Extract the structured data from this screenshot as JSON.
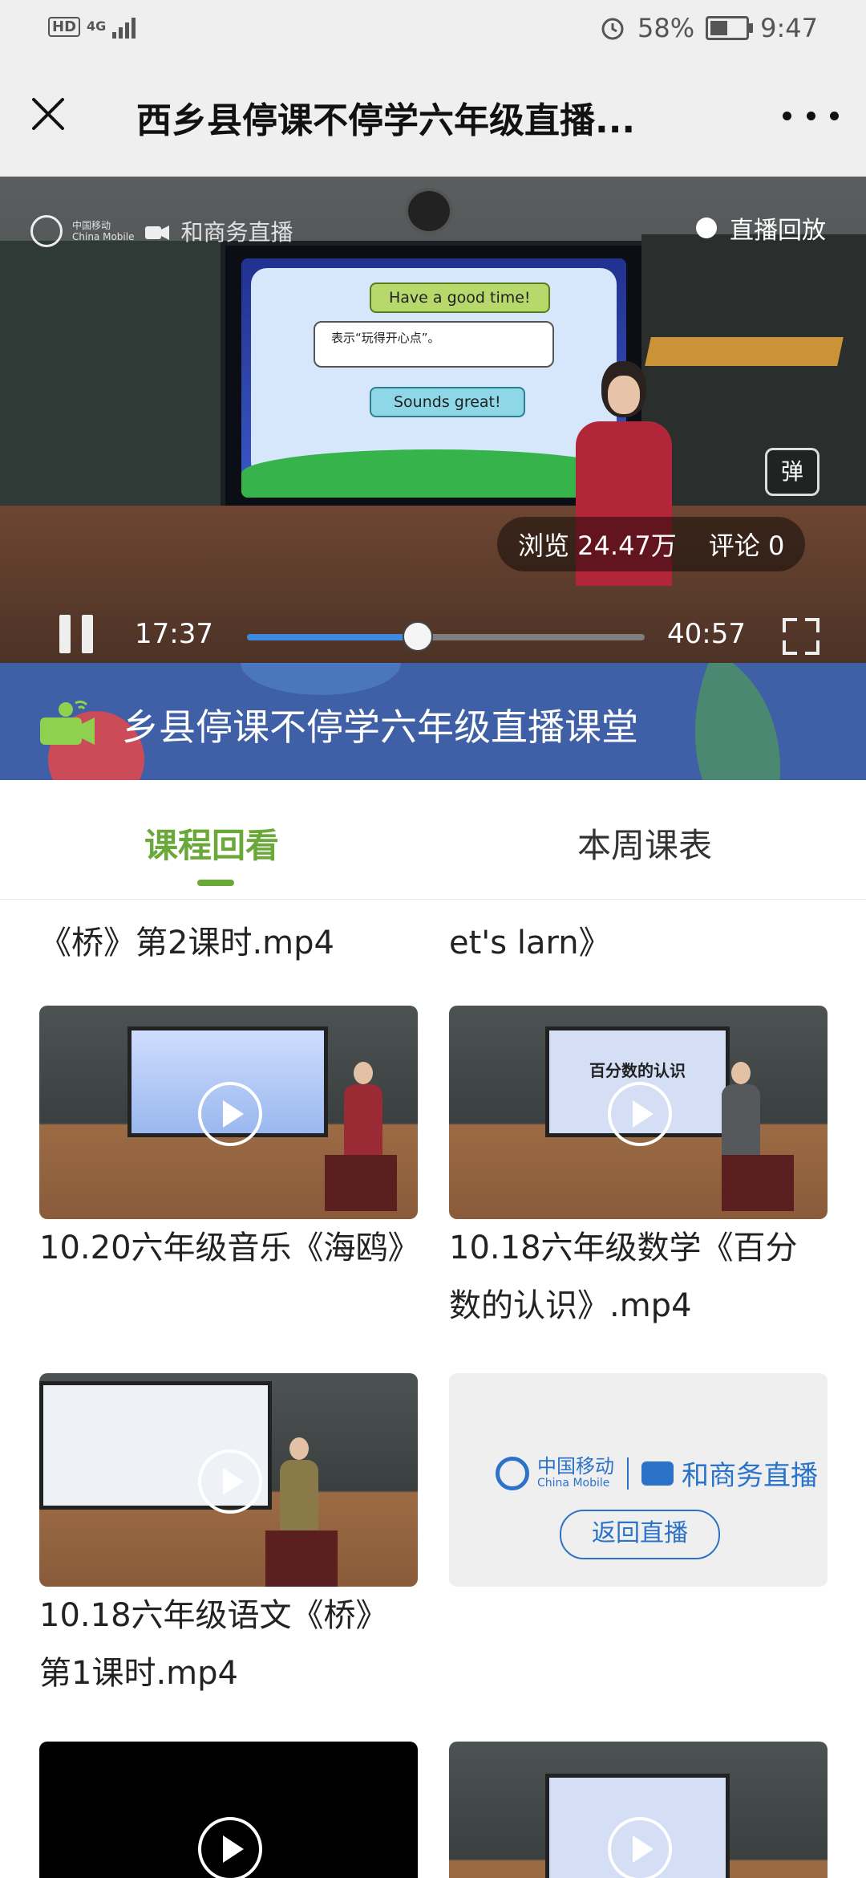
{
  "status_bar": {
    "hd": "HD",
    "network": "4G",
    "battery_percent": "58%",
    "time": "9:47",
    "battery_level": 0.58
  },
  "header": {
    "title": "西乡县停课不停学六年级直播..."
  },
  "player": {
    "brand_text": "和商务直播",
    "brand_cm_cn": "中国移动",
    "brand_cm_en": "China Mobile",
    "replay_label": "直播回放",
    "danmu_label": "弹",
    "views": "浏览 24.47万",
    "comments": "评论 0",
    "current_time": "17:37",
    "total_time": "40:57",
    "progress_fraction": 0.43,
    "slide": {
      "line1": "Have a good time!",
      "line2": "表示“玩得开心点”。",
      "line3": "Sounds great!"
    }
  },
  "banner": {
    "title": "乡县停课不停学六年级直播课堂"
  },
  "tabs": [
    {
      "label": "课程回看",
      "active": true
    },
    {
      "label": "本周课表",
      "active": false
    }
  ],
  "videos": {
    "partial_left": {
      "title_line1": "《桥》第2课时.mp4"
    },
    "partial_right": {
      "title_line1": "et's larn》"
    },
    "items": [
      {
        "title": "10.20六年级音乐《海鸥》"
      },
      {
        "title": "10.18六年级数学《百分数的认识》.mp4",
        "screen_text": "百分数的认识"
      },
      {
        "title": "10.18六年级语文《桥》第1课时.mp4"
      }
    ],
    "return_card": {
      "cm_cn": "中国移动",
      "cm_en": "China Mobile",
      "service": "和商务直播",
      "button": "返回直播"
    }
  },
  "colors": {
    "accent_green": "#6aa83a",
    "progress_blue": "#3b8ae0",
    "china_mobile_blue": "#2a73c8"
  }
}
